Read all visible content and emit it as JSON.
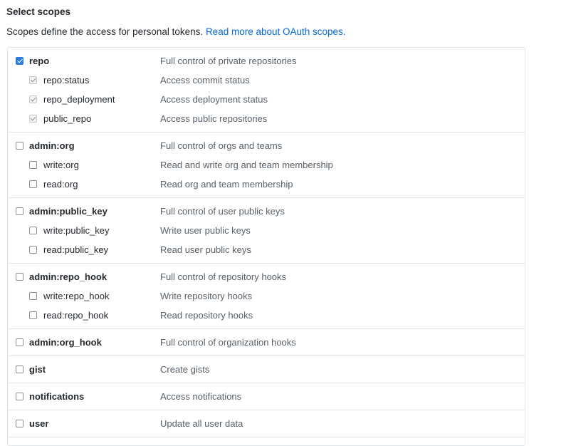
{
  "header": {
    "title": "Select scopes",
    "description": "Scopes define the access for personal tokens.",
    "link_text": "Read more about OAuth scopes."
  },
  "scope_groups": [
    {
      "name": "repo",
      "description": "Full control of private repositories",
      "checked": true,
      "children": [
        {
          "name": "repo:status",
          "description": "Access commit status",
          "checked": true
        },
        {
          "name": "repo_deployment",
          "description": "Access deployment status",
          "checked": true
        },
        {
          "name": "public_repo",
          "description": "Access public repositories",
          "checked": true
        }
      ]
    },
    {
      "name": "admin:org",
      "description": "Full control of orgs and teams",
      "checked": false,
      "children": [
        {
          "name": "write:org",
          "description": "Read and write org and team membership",
          "checked": false
        },
        {
          "name": "read:org",
          "description": "Read org and team membership",
          "checked": false
        }
      ]
    },
    {
      "name": "admin:public_key",
      "description": "Full control of user public keys",
      "checked": false,
      "children": [
        {
          "name": "write:public_key",
          "description": "Write user public keys",
          "checked": false
        },
        {
          "name": "read:public_key",
          "description": "Read user public keys",
          "checked": false
        }
      ]
    },
    {
      "name": "admin:repo_hook",
      "description": "Full control of repository hooks",
      "checked": false,
      "children": [
        {
          "name": "write:repo_hook",
          "description": "Write repository hooks",
          "checked": false
        },
        {
          "name": "read:repo_hook",
          "description": "Read repository hooks",
          "checked": false
        }
      ]
    },
    {
      "name": "admin:org_hook",
      "description": "Full control of organization hooks",
      "checked": false,
      "children": []
    },
    {
      "name": "gist",
      "description": "Create gists",
      "checked": false,
      "children": []
    },
    {
      "name": "notifications",
      "description": "Access notifications",
      "checked": false,
      "children": []
    },
    {
      "name": "user",
      "description": "Update all user data",
      "checked": false,
      "children": []
    }
  ]
}
